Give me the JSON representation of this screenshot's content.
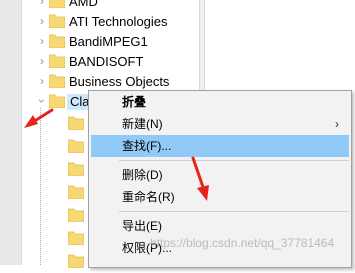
{
  "tree": {
    "items": [
      {
        "label": "AMD",
        "expanded": false
      },
      {
        "label": "ATI Technologies",
        "expanded": false
      },
      {
        "label": "BandiMPEG1",
        "expanded": false
      },
      {
        "label": "BANDISOFT",
        "expanded": false
      },
      {
        "label": "Business Objects",
        "expanded": false
      },
      {
        "label": "Cla",
        "expanded": true,
        "selected": true
      }
    ],
    "child_count": 7
  },
  "context_menu": {
    "title": "折叠",
    "items": [
      {
        "label": "新建(N)",
        "has_submenu": true
      },
      {
        "label": "查找(F)...",
        "highlighted": true
      },
      {
        "label": "删除(D)"
      },
      {
        "label": "重命名(R)"
      },
      {
        "label": "导出(E)"
      },
      {
        "label": "权限(P)..."
      }
    ]
  },
  "watermark": "https://blog.csdn.net/qq_37781464",
  "colors": {
    "annotation_arrow": "#e8231a",
    "folder": "#f8d775",
    "selection": "#cce8ff",
    "menu_highlight": "#91c9f7"
  }
}
